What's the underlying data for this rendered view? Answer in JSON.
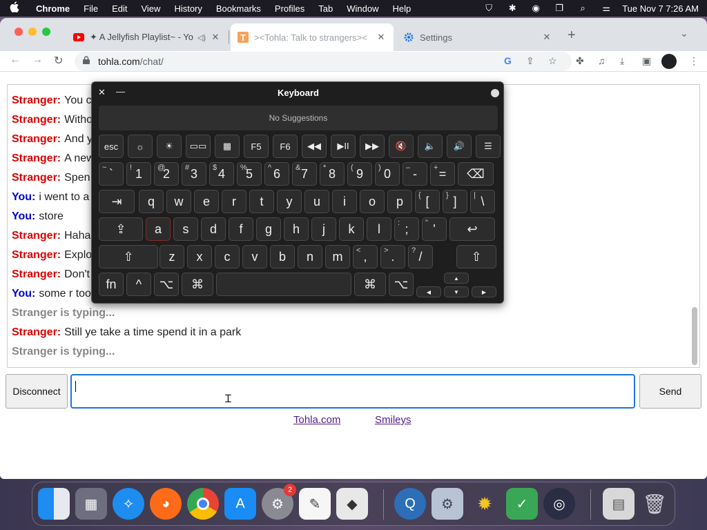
{
  "menubar": {
    "app_name": "Chrome",
    "items": [
      "File",
      "Edit",
      "View",
      "History",
      "Bookmarks",
      "Profiles",
      "Tab",
      "Window",
      "Help"
    ],
    "clock": "Tue Nov 7  7:26 AM"
  },
  "tabs": [
    {
      "title": "✦ A Jellyfish Playlist~ - Yo",
      "icon": "youtube-icon"
    },
    {
      "title": "><Tohla: Talk to strangers><",
      "icon": "tohla-icon"
    },
    {
      "title": "Settings",
      "icon": "gear-icon"
    }
  ],
  "omnibox": {
    "domain": "tohla.com",
    "path": "/chat/"
  },
  "messages": [
    {
      "who": "Stranger:",
      "text": "You c"
    },
    {
      "who": "Stranger:",
      "text": "Witho"
    },
    {
      "who": "Stranger:",
      "text": "And y"
    },
    {
      "who": "Stranger:",
      "text": "A new"
    },
    {
      "who": "Stranger:",
      "text": "Spen"
    },
    {
      "who": "You:",
      "text": "i went to a"
    },
    {
      "who": "You:",
      "text": "store"
    },
    {
      "who": "Stranger:",
      "text": "Haha"
    },
    {
      "who": "Stranger:",
      "text": "Explo"
    },
    {
      "who": "Stranger:",
      "text": "Don't"
    },
    {
      "who": "You:",
      "text": "some r too"
    },
    {
      "status": "Stranger is typing..."
    },
    {
      "who": "Stranger:",
      "text": "Still ye take a time spend it in a park"
    },
    {
      "status": "Stranger is typing..."
    }
  ],
  "controls": {
    "disconnect": "Disconnect",
    "send": "Send",
    "input_value": ""
  },
  "footer_links": [
    "Tohla.com",
    "Smileys"
  ],
  "keyboard": {
    "title": "Keyboard",
    "suggestions": "No Suggestions",
    "fn_row": [
      "esc",
      "☼",
      "☀",
      "▭▭",
      "▦",
      "F5",
      "F6",
      "◀◀",
      "▶II",
      "▶▶",
      "🔇",
      "🔈",
      "🔊",
      "☰"
    ],
    "num_row": [
      {
        "main": "`",
        "sup": "~"
      },
      {
        "main": "1",
        "sup": "!"
      },
      {
        "main": "2",
        "sup": "@"
      },
      {
        "main": "3",
        "sup": "#"
      },
      {
        "main": "4",
        "sup": "$"
      },
      {
        "main": "5",
        "sup": "%"
      },
      {
        "main": "6",
        "sup": "^"
      },
      {
        "main": "7",
        "sup": "&"
      },
      {
        "main": "8",
        "sup": "*"
      },
      {
        "main": "9",
        "sup": "("
      },
      {
        "main": "0",
        "sup": ")"
      },
      {
        "main": "-",
        "sup": "–"
      },
      {
        "main": "=",
        "sup": "+"
      },
      {
        "main": "⌫",
        "sup": ""
      }
    ],
    "row_q": [
      "⇥",
      "q",
      "w",
      "e",
      "r",
      "t",
      "y",
      "u",
      "i",
      "o",
      "p",
      "[",
      "]",
      "\\"
    ],
    "row_q_sup": [
      "",
      "",
      "",
      "",
      "",
      "",
      "",
      "",
      "",
      "",
      "",
      "{",
      "}",
      "|"
    ],
    "row_a": [
      "⇪",
      "a",
      "s",
      "d",
      "f",
      "g",
      "h",
      "j",
      "k",
      "l",
      ";",
      "'",
      "↩"
    ],
    "row_a_sup": [
      "",
      "",
      "",
      "",
      "",
      "",
      "",
      "",
      "",
      "",
      ":",
      "\"",
      ""
    ],
    "row_z": [
      "⇧",
      "z",
      "x",
      "c",
      "v",
      "b",
      "n",
      "m",
      ",",
      ".",
      "/",
      "⇧"
    ],
    "row_z_sup": [
      "",
      "",
      "",
      "",
      "",
      "",
      "",
      "",
      "<",
      ">",
      "?",
      ""
    ],
    "row_bottom": [
      "fn",
      "^",
      "⌥",
      "⌘",
      "",
      "⌘",
      "⌥"
    ],
    "arrows": [
      "▲",
      "◀",
      "▼",
      "▶"
    ]
  },
  "dock": {
    "apps": [
      "finder-icon",
      "launchpad-icon",
      "safari-icon",
      "firefox-icon",
      "chrome-icon",
      "app-store-icon",
      "system-preferences-icon",
      "textedit-icon",
      "roblox-icon",
      "quicktime-icon",
      "settings-gear-icon",
      "bee-icon",
      "adguard-icon",
      "obs-icon",
      "document-stack-icon",
      "trash-icon"
    ],
    "badge": "2"
  }
}
